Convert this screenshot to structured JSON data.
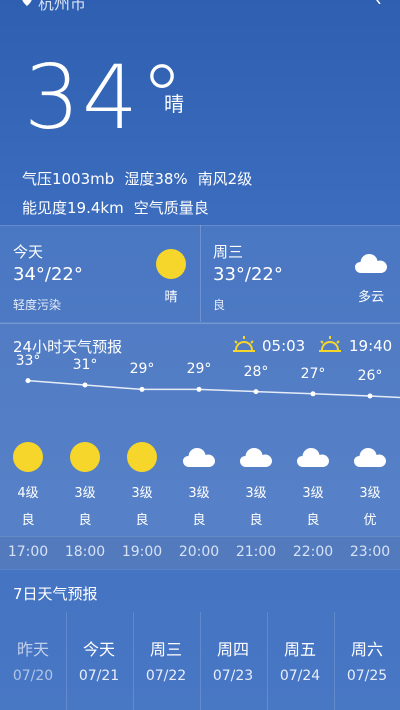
{
  "header": {
    "city": "杭州市",
    "location_icon": "location-pin-icon",
    "share_icon": "share-icon"
  },
  "current": {
    "temperature": "34°",
    "condition": "晴",
    "pressure": "气压1003mb",
    "humidity": "湿度38%",
    "wind": "南风2级",
    "visibility": "能见度19.4km",
    "air_quality": "空气质量良"
  },
  "today": {
    "label": "今天",
    "temps": "34°/22°",
    "aqi": "轻度污染",
    "condition": "晴",
    "icon": "sun-icon"
  },
  "tomorrow": {
    "label": "周三",
    "temps": "33°/22°",
    "aqi": "良",
    "condition": "多云",
    "icon": "cloud-icon"
  },
  "hourly": {
    "title": "24小时天气预报",
    "sunrise": "05:03",
    "sunset": "19:40",
    "hours": [
      {
        "temp": "33°",
        "t": 33,
        "icon": "sun-icon",
        "wind": "4级",
        "aqi": "良",
        "time": "17:00"
      },
      {
        "temp": "31°",
        "t": 31,
        "icon": "sun-icon",
        "wind": "3级",
        "aqi": "良",
        "time": "18:00"
      },
      {
        "temp": "29°",
        "t": 29,
        "icon": "sun-icon",
        "wind": "3级",
        "aqi": "良",
        "time": "19:00"
      },
      {
        "temp": "29°",
        "t": 29,
        "icon": "cloud-icon",
        "wind": "3级",
        "aqi": "良",
        "time": "20:00"
      },
      {
        "temp": "28°",
        "t": 28,
        "icon": "cloud-icon",
        "wind": "3级",
        "aqi": "良",
        "time": "21:00"
      },
      {
        "temp": "27°",
        "t": 27,
        "icon": "cloud-icon",
        "wind": "3级",
        "aqi": "良",
        "time": "22:00"
      },
      {
        "temp": "26°",
        "t": 26,
        "icon": "cloud-icon",
        "wind": "3级",
        "aqi": "优",
        "time": "23:00"
      }
    ]
  },
  "weekly": {
    "title": "7日天气预报",
    "days": [
      {
        "name": "昨天",
        "date": "07/20"
      },
      {
        "name": "今天",
        "date": "07/21"
      },
      {
        "name": "周三",
        "date": "07/22"
      },
      {
        "name": "周四",
        "date": "07/23"
      },
      {
        "name": "周五",
        "date": "07/24"
      },
      {
        "name": "周六",
        "date": "07/25"
      }
    ]
  },
  "colors": {
    "sun": "#f6d62a",
    "cloud": "#ffffff",
    "background": "#3b6cbd"
  }
}
